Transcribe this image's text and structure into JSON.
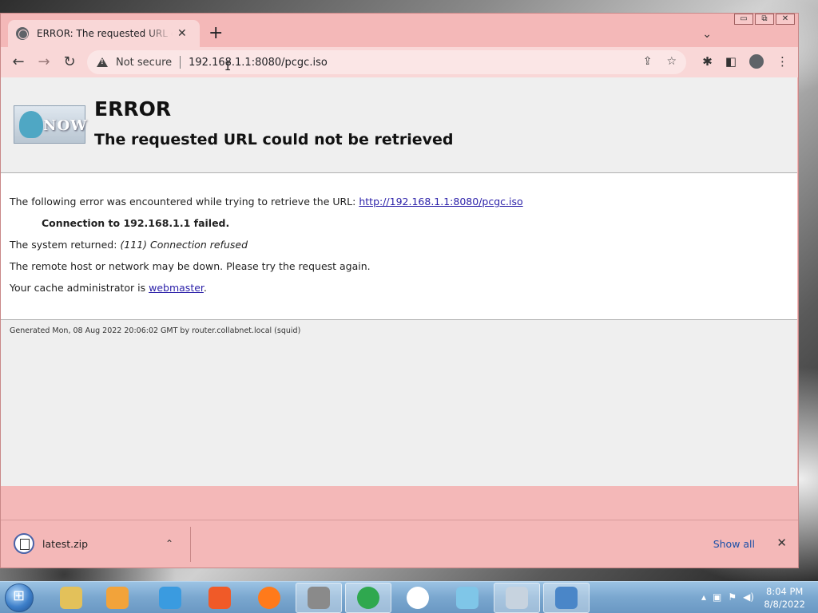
{
  "browser": {
    "tab_title": "ERROR: The requested URL could",
    "new_tab_label": "+",
    "tab_close": "✕",
    "tab_search": "⌄",
    "window_controls": [
      "▭",
      "⧉",
      "✕"
    ]
  },
  "toolbar": {
    "back": "←",
    "forward": "→",
    "reload": "↻",
    "security_label": "Not secure",
    "url": "192.168.1.1:8080/pcgc.iso",
    "share_icon": "⇪",
    "star_icon": "☆",
    "extensions_icon": "✱",
    "sidepanel_icon": "◧",
    "menu_icon": "⋮"
  },
  "page": {
    "logo_text": "NOW",
    "title": "ERROR",
    "subtitle": "The requested URL could not be retrieved",
    "line1_prefix": "The following error was encountered while trying to retrieve the URL: ",
    "line1_link": "http://192.168.1.1:8080/pcgc.iso",
    "line2": "Connection to 192.168.1.1 failed.",
    "line3_prefix": "The system returned: ",
    "line3_value": "(111) Connection refused",
    "line4": "The remote host or network may be down. Please try the request again.",
    "line5_prefix": "Your cache administrator is ",
    "line5_link": "webmaster",
    "line5_suffix": ".",
    "generated": "Generated Mon, 08 Aug 2022 20:06:02 GMT by router.collabnet.local (squid)"
  },
  "downloads": {
    "file_name": "latest.zip",
    "chevron": "⌃",
    "show_all": "Show all",
    "close": "✕"
  },
  "taskbar": {
    "apps": [
      {
        "name": "file-explorer",
        "color": "#e3c15a"
      },
      {
        "name": "media-player",
        "color": "#f2a33a"
      },
      {
        "name": "app-w",
        "color": "#3a9be0"
      },
      {
        "name": "brave",
        "color": "#f05a28"
      },
      {
        "name": "firefox",
        "color": "#ff7a1a"
      },
      {
        "name": "raccoon-app",
        "color": "#8a8a8a"
      },
      {
        "name": "chrome",
        "color": "#2fa84f"
      },
      {
        "name": "yandex",
        "color": "#ffffff"
      },
      {
        "name": "notepad",
        "color": "#7fc6e8"
      },
      {
        "name": "disk-app",
        "color": "#c7d3df"
      },
      {
        "name": "control-panel",
        "color": "#4a86c8"
      }
    ],
    "time": "8:04 PM",
    "date": "8/8/2022"
  }
}
